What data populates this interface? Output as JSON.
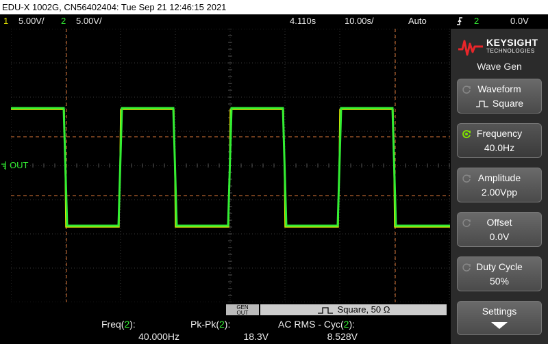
{
  "title": "EDU-X 1002G, CN56402404: Tue Sep 21 12:46:15 2021",
  "status": {
    "ch1_num": "1",
    "ch1_scale": "5.00V/",
    "ch2_num": "2",
    "ch2_scale": "5.00V/",
    "delay": "4.110s",
    "timebase": "10.00s/",
    "mode": "Auto",
    "trigger_icon": "trigger-edge-icon",
    "trigger_channel": "2",
    "trigger_level": "0.0V"
  },
  "graticule": {
    "ground_label": "OUT",
    "trace_colors": {
      "ch1": "#e8e800",
      "ch2": "#33ee33"
    }
  },
  "wavegen": {
    "label": "GEN OUT",
    "info": "Square, 50 Ω"
  },
  "measurements": [
    {
      "name": "Freq(",
      "channel": "2",
      "close": "):",
      "value": "40.000Hz"
    },
    {
      "name": "Pk-Pk(",
      "channel": "2",
      "close": "):",
      "value": "18.3V"
    },
    {
      "name": "AC RMS - Cyc(",
      "channel": "2",
      "close": "):",
      "value": "8.528V"
    }
  ],
  "sidebar": {
    "brand": "KEYSIGHT",
    "brand_sub": "TECHNOLOGIES",
    "menu_title": "Wave Gen",
    "buttons": [
      {
        "label": "Waveform",
        "value": "Square"
      },
      {
        "label": "Frequency",
        "value": "40.0Hz"
      },
      {
        "label": "Amplitude",
        "value": "2.00Vpp"
      },
      {
        "label": "Offset",
        "value": "0.0V"
      },
      {
        "label": "Duty Cycle",
        "value": "50%"
      },
      {
        "label": "Settings",
        "value": ""
      }
    ]
  }
}
